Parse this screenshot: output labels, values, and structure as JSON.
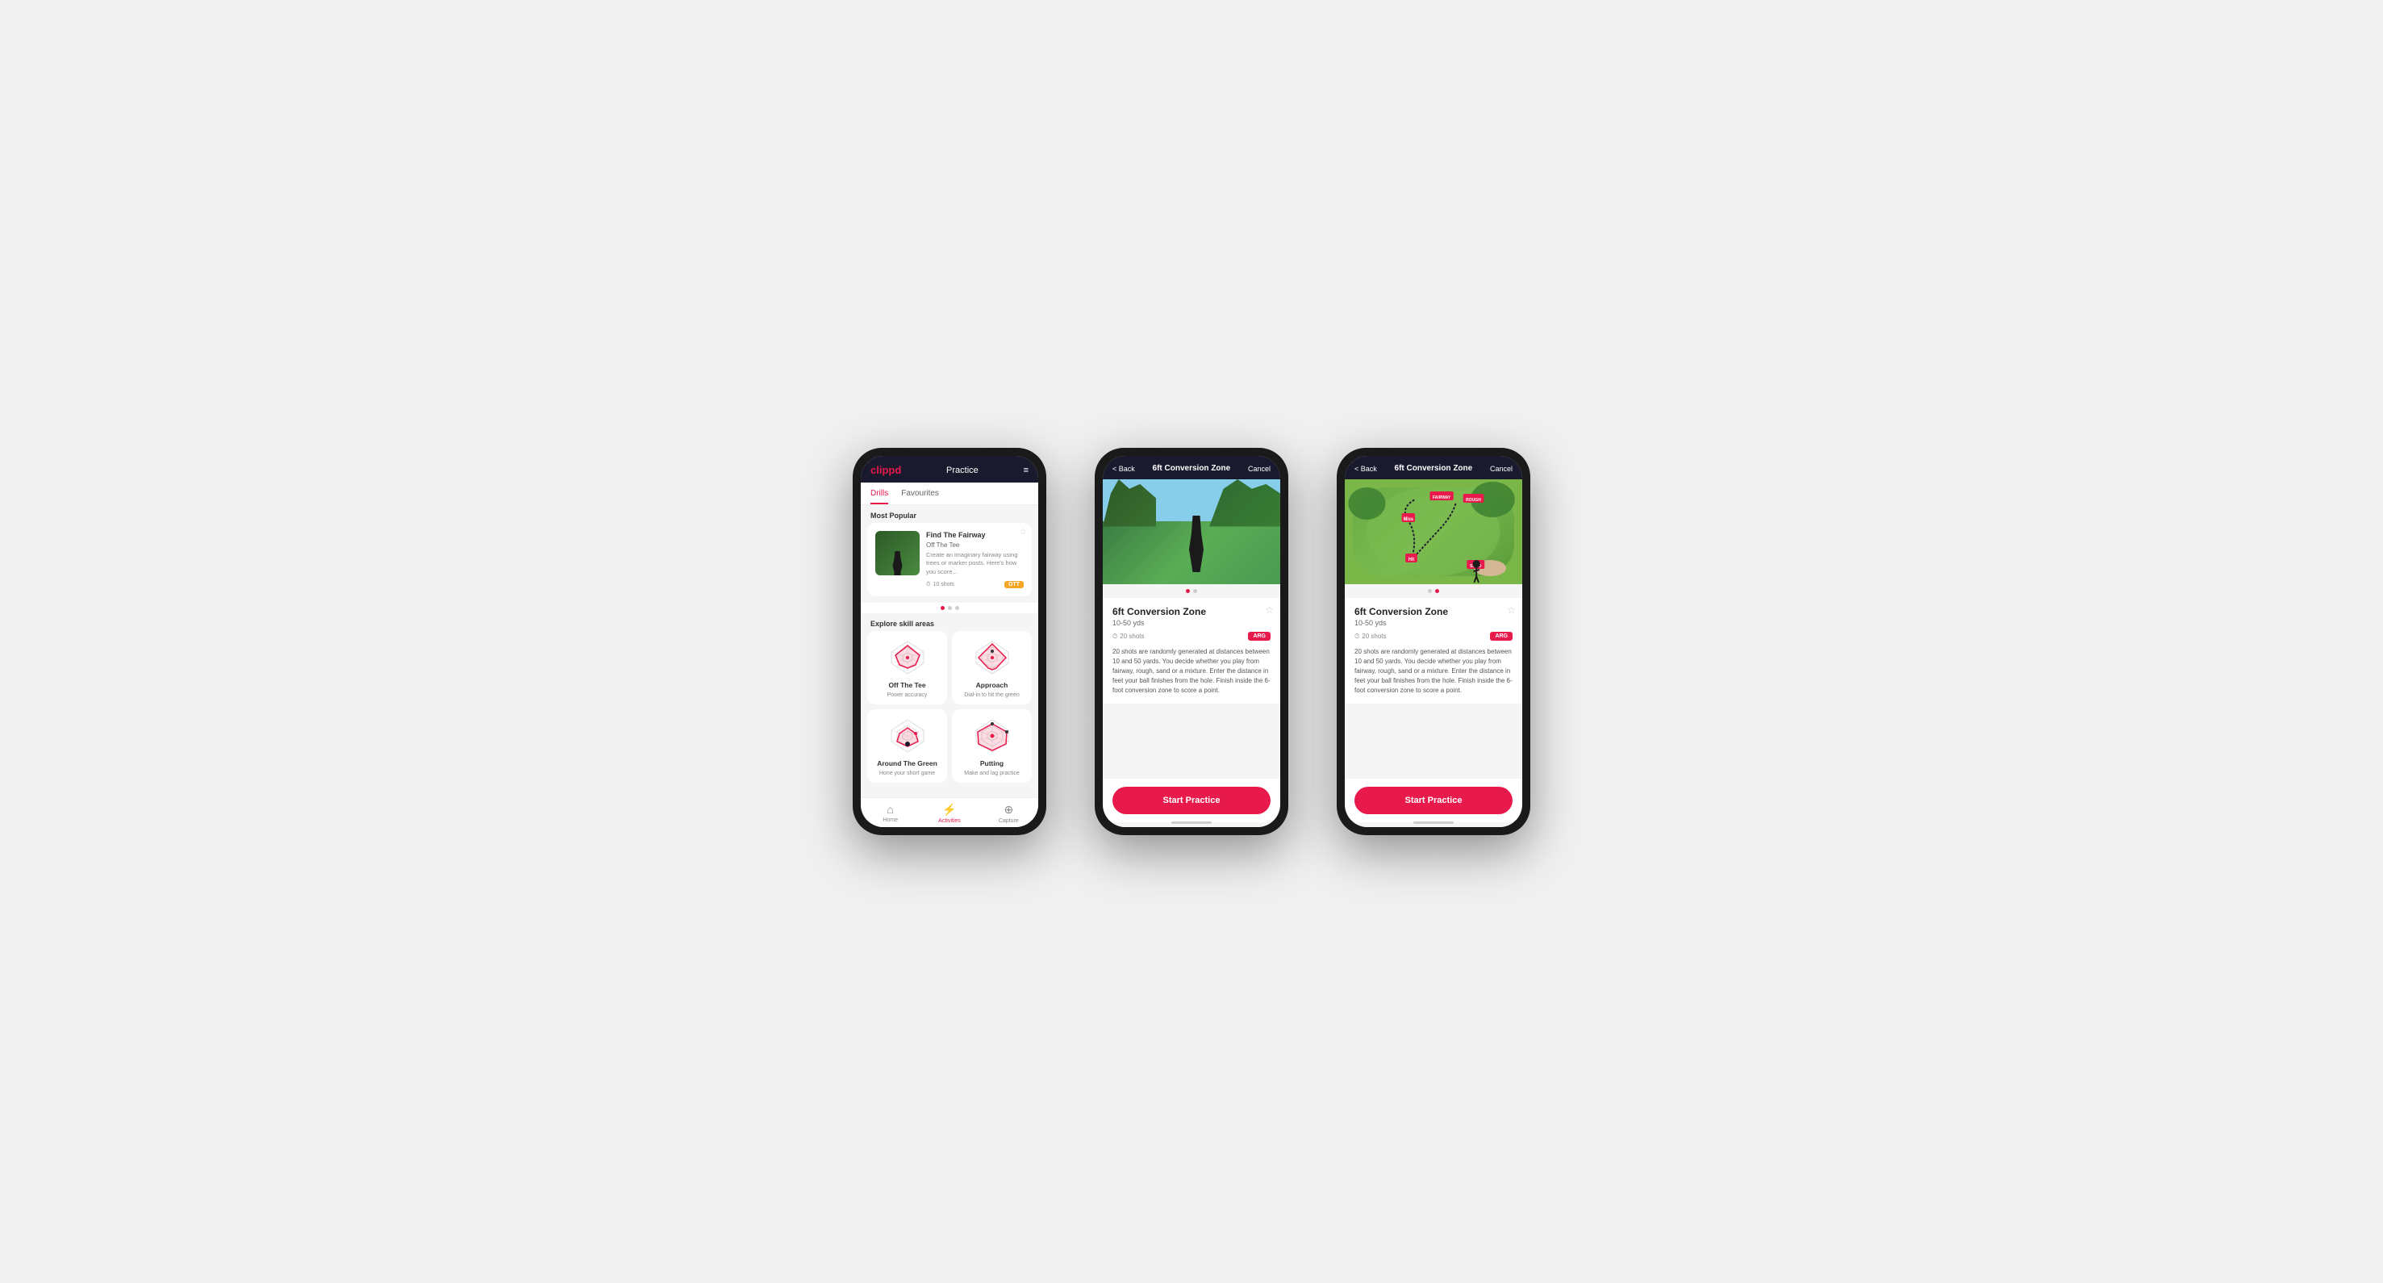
{
  "phones": {
    "phone1": {
      "header": {
        "logo": "clippd",
        "title": "Practice",
        "menu_icon": "≡"
      },
      "tabs": [
        {
          "label": "Drills",
          "active": true
        },
        {
          "label": "Favourites",
          "active": false
        }
      ],
      "most_popular_label": "Most Popular",
      "featured_drill": {
        "title": "Find The Fairway",
        "subtitle": "Off The Tee",
        "description": "Create an imaginary fairway using trees or marker posts. Here's how you score...",
        "shots": "10 shots",
        "tag": "OTT"
      },
      "explore_label": "Explore skill areas",
      "skills": [
        {
          "name": "Off The Tee",
          "description": "Power accuracy",
          "icon": "ott"
        },
        {
          "name": "Approach",
          "description": "Dial-in to hit the green",
          "icon": "approach"
        },
        {
          "name": "Around The Green",
          "description": "Hone your short game",
          "icon": "atg"
        },
        {
          "name": "Putting",
          "description": "Make and lag practice",
          "icon": "putting"
        }
      ],
      "navbar": [
        {
          "label": "Home",
          "icon": "⌂",
          "active": false
        },
        {
          "label": "Activities",
          "icon": "⚡",
          "active": true
        },
        {
          "label": "Capture",
          "icon": "⊕",
          "active": false
        }
      ]
    },
    "phone2": {
      "header": {
        "back_label": "< Back",
        "title": "6ft Conversion Zone",
        "cancel_label": "Cancel"
      },
      "drill": {
        "title": "6ft Conversion Zone",
        "yardage": "10-50 yds",
        "shots": "20 shots",
        "tag": "ARG",
        "description": "20 shots are randomly generated at distances between 10 and 50 yards. You decide whether you play from fairway, rough, sand or a mixture. Enter the distance in feet your ball finishes from the hole. Finish inside the 6-foot conversion zone to score a point."
      },
      "start_button": "Start Practice",
      "image_type": "photo"
    },
    "phone3": {
      "header": {
        "back_label": "< Back",
        "title": "6ft Conversion Zone",
        "cancel_label": "Cancel"
      },
      "drill": {
        "title": "6ft Conversion Zone",
        "yardage": "10-50 yds",
        "shots": "20 shots",
        "tag": "ARG",
        "description": "20 shots are randomly generated at distances between 10 and 50 yards. You decide whether you play from fairway, rough, sand or a mixture. Enter the distance in feet your ball finishes from the hole. Finish inside the 6-foot conversion zone to score a point."
      },
      "start_button": "Start Practice",
      "image_type": "map"
    }
  }
}
